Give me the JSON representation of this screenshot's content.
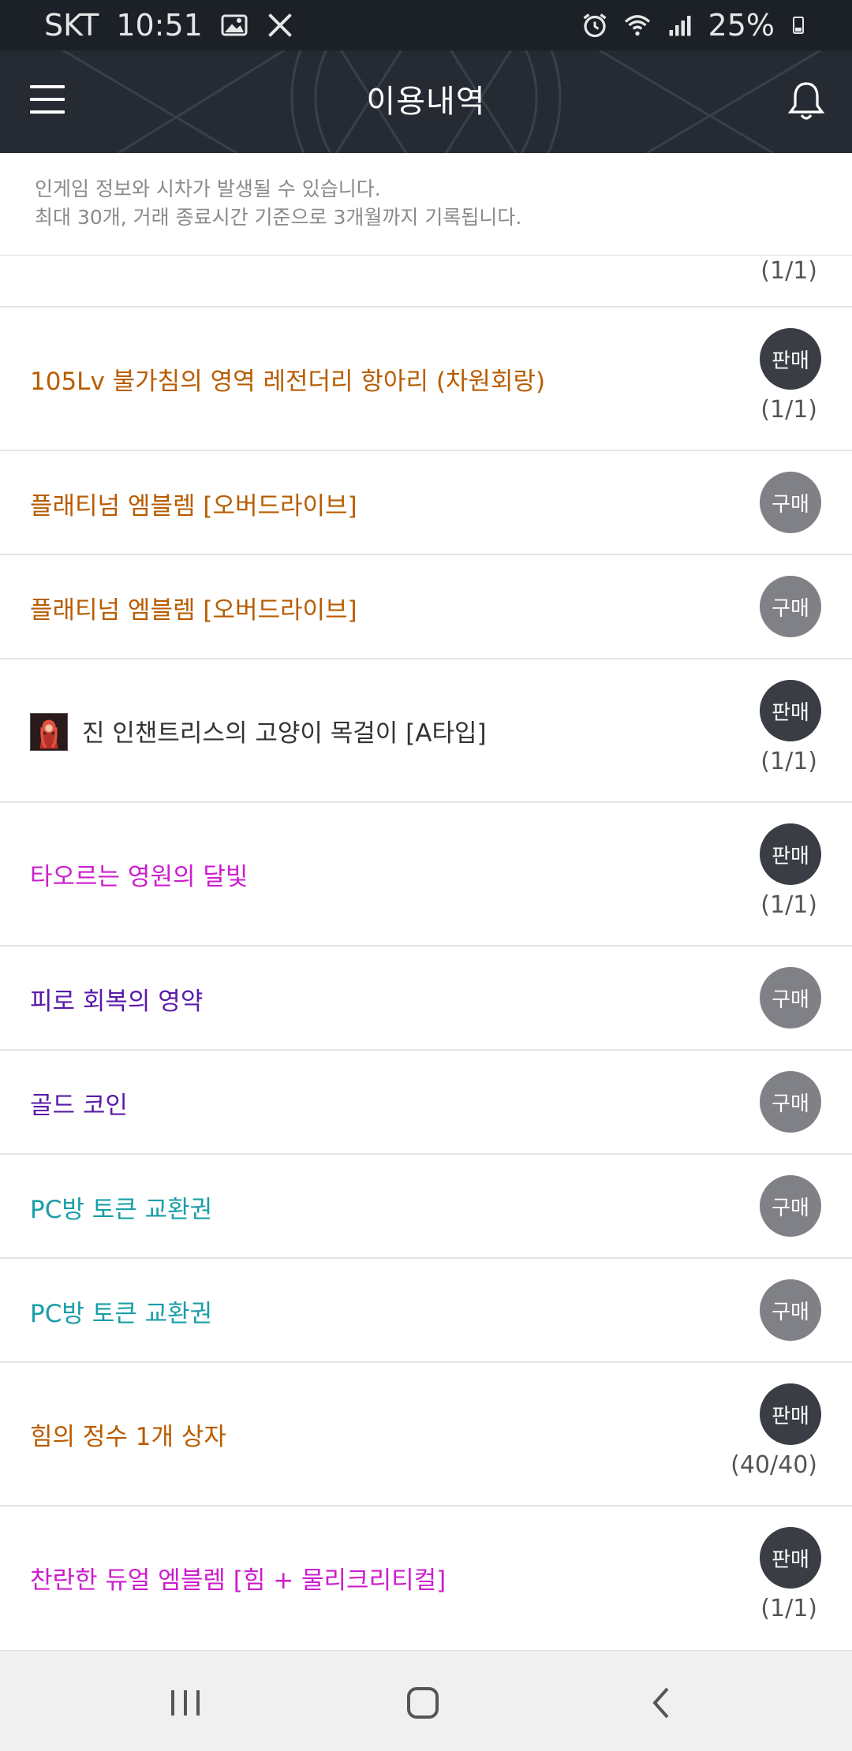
{
  "status_bar": {
    "carrier": "SKT",
    "time": "10:51",
    "battery": "25%"
  },
  "header": {
    "title": "이용내역"
  },
  "notice": {
    "line1": "인게임 정보와 시차가 발생될 수 있습니다.",
    "line2": "최대 30개, 거래 종료시간 기준으로 3개월까지 기록됩니다."
  },
  "items": [
    {
      "name": "",
      "badge": "",
      "qty": "(1/1)",
      "color": "#b85c00"
    },
    {
      "name": "105Lv 불가침의 영역 레전더리 항아리 (차원회랑)",
      "badge": "판매",
      "type": "sell",
      "qty": "(1/1)",
      "color": "#b85c00"
    },
    {
      "name": "플래티넘 엠블렘 [오버드라이브]",
      "badge": "구매",
      "type": "buy",
      "qty": "",
      "color": "#b85c00"
    },
    {
      "name": "플래티넘 엠블렘 [오버드라이브]",
      "badge": "구매",
      "type": "buy",
      "qty": "",
      "color": "#b85c00"
    },
    {
      "name": "진 인챈트리스의 고양이 목걸이 [A타입]",
      "badge": "판매",
      "type": "sell",
      "qty": "(1/1)",
      "color": "#333333",
      "icon": "character-avatar-icon"
    },
    {
      "name": "타오르는 영원의 달빛",
      "badge": "판매",
      "type": "sell",
      "qty": "(1/1)",
      "color": "#cc1ecc"
    },
    {
      "name": "피로 회복의 영약",
      "badge": "구매",
      "type": "buy",
      "qty": "",
      "color": "#5a1aa8"
    },
    {
      "name": "골드 코인",
      "badge": "구매",
      "type": "buy",
      "qty": "",
      "color": "#5a1aa8"
    },
    {
      "name": "PC방 토큰 교환권",
      "badge": "구매",
      "type": "buy",
      "qty": "",
      "color": "#1a9ea8"
    },
    {
      "name": "PC방 토큰 교환권",
      "badge": "구매",
      "type": "buy",
      "qty": "",
      "color": "#1a9ea8"
    },
    {
      "name": "힘의 정수 1개 상자",
      "badge": "판매",
      "type": "sell",
      "qty": "(40/40)",
      "color": "#b85c00"
    },
    {
      "name": "찬란한 듀얼 엠블렘 [힘 + 물리크리티컬]",
      "badge": "판매",
      "type": "sell",
      "qty": "(1/1)",
      "color": "#cc1ecc"
    }
  ],
  "nav": {
    "icons": [
      "recent-apps-icon",
      "home-icon",
      "back-icon"
    ]
  }
}
